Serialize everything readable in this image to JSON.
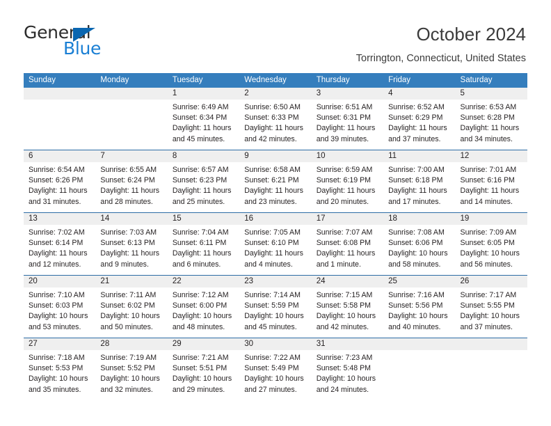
{
  "brand": {
    "name_top": "General",
    "name_bottom": "Blue",
    "accent_color": "#1a7fd4",
    "triangle_color": "#0a66b0"
  },
  "header": {
    "title": "October 2024",
    "subtitle": "Torrington, Connecticut, United States"
  },
  "calendar": {
    "header_bg": "#357ebd",
    "header_text_color": "#ffffff",
    "date_bar_bg": "#efefef",
    "row_divider_color": "#2c6ca5",
    "weekdays": [
      "Sunday",
      "Monday",
      "Tuesday",
      "Wednesday",
      "Thursday",
      "Friday",
      "Saturday"
    ],
    "weeks": [
      [
        {
          "day": "",
          "lines": []
        },
        {
          "day": "",
          "lines": []
        },
        {
          "day": "1",
          "lines": [
            "Sunrise: 6:49 AM",
            "Sunset: 6:34 PM",
            "Daylight: 11 hours",
            "and 45 minutes."
          ]
        },
        {
          "day": "2",
          "lines": [
            "Sunrise: 6:50 AM",
            "Sunset: 6:33 PM",
            "Daylight: 11 hours",
            "and 42 minutes."
          ]
        },
        {
          "day": "3",
          "lines": [
            "Sunrise: 6:51 AM",
            "Sunset: 6:31 PM",
            "Daylight: 11 hours",
            "and 39 minutes."
          ]
        },
        {
          "day": "4",
          "lines": [
            "Sunrise: 6:52 AM",
            "Sunset: 6:29 PM",
            "Daylight: 11 hours",
            "and 37 minutes."
          ]
        },
        {
          "day": "5",
          "lines": [
            "Sunrise: 6:53 AM",
            "Sunset: 6:28 PM",
            "Daylight: 11 hours",
            "and 34 minutes."
          ]
        }
      ],
      [
        {
          "day": "6",
          "lines": [
            "Sunrise: 6:54 AM",
            "Sunset: 6:26 PM",
            "Daylight: 11 hours",
            "and 31 minutes."
          ]
        },
        {
          "day": "7",
          "lines": [
            "Sunrise: 6:55 AM",
            "Sunset: 6:24 PM",
            "Daylight: 11 hours",
            "and 28 minutes."
          ]
        },
        {
          "day": "8",
          "lines": [
            "Sunrise: 6:57 AM",
            "Sunset: 6:23 PM",
            "Daylight: 11 hours",
            "and 25 minutes."
          ]
        },
        {
          "day": "9",
          "lines": [
            "Sunrise: 6:58 AM",
            "Sunset: 6:21 PM",
            "Daylight: 11 hours",
            "and 23 minutes."
          ]
        },
        {
          "day": "10",
          "lines": [
            "Sunrise: 6:59 AM",
            "Sunset: 6:19 PM",
            "Daylight: 11 hours",
            "and 20 minutes."
          ]
        },
        {
          "day": "11",
          "lines": [
            "Sunrise: 7:00 AM",
            "Sunset: 6:18 PM",
            "Daylight: 11 hours",
            "and 17 minutes."
          ]
        },
        {
          "day": "12",
          "lines": [
            "Sunrise: 7:01 AM",
            "Sunset: 6:16 PM",
            "Daylight: 11 hours",
            "and 14 minutes."
          ]
        }
      ],
      [
        {
          "day": "13",
          "lines": [
            "Sunrise: 7:02 AM",
            "Sunset: 6:14 PM",
            "Daylight: 11 hours",
            "and 12 minutes."
          ]
        },
        {
          "day": "14",
          "lines": [
            "Sunrise: 7:03 AM",
            "Sunset: 6:13 PM",
            "Daylight: 11 hours",
            "and 9 minutes."
          ]
        },
        {
          "day": "15",
          "lines": [
            "Sunrise: 7:04 AM",
            "Sunset: 6:11 PM",
            "Daylight: 11 hours",
            "and 6 minutes."
          ]
        },
        {
          "day": "16",
          "lines": [
            "Sunrise: 7:05 AM",
            "Sunset: 6:10 PM",
            "Daylight: 11 hours",
            "and 4 minutes."
          ]
        },
        {
          "day": "17",
          "lines": [
            "Sunrise: 7:07 AM",
            "Sunset: 6:08 PM",
            "Daylight: 11 hours",
            "and 1 minute."
          ]
        },
        {
          "day": "18",
          "lines": [
            "Sunrise: 7:08 AM",
            "Sunset: 6:06 PM",
            "Daylight: 10 hours",
            "and 58 minutes."
          ]
        },
        {
          "day": "19",
          "lines": [
            "Sunrise: 7:09 AM",
            "Sunset: 6:05 PM",
            "Daylight: 10 hours",
            "and 56 minutes."
          ]
        }
      ],
      [
        {
          "day": "20",
          "lines": [
            "Sunrise: 7:10 AM",
            "Sunset: 6:03 PM",
            "Daylight: 10 hours",
            "and 53 minutes."
          ]
        },
        {
          "day": "21",
          "lines": [
            "Sunrise: 7:11 AM",
            "Sunset: 6:02 PM",
            "Daylight: 10 hours",
            "and 50 minutes."
          ]
        },
        {
          "day": "22",
          "lines": [
            "Sunrise: 7:12 AM",
            "Sunset: 6:00 PM",
            "Daylight: 10 hours",
            "and 48 minutes."
          ]
        },
        {
          "day": "23",
          "lines": [
            "Sunrise: 7:14 AM",
            "Sunset: 5:59 PM",
            "Daylight: 10 hours",
            "and 45 minutes."
          ]
        },
        {
          "day": "24",
          "lines": [
            "Sunrise: 7:15 AM",
            "Sunset: 5:58 PM",
            "Daylight: 10 hours",
            "and 42 minutes."
          ]
        },
        {
          "day": "25",
          "lines": [
            "Sunrise: 7:16 AM",
            "Sunset: 5:56 PM",
            "Daylight: 10 hours",
            "and 40 minutes."
          ]
        },
        {
          "day": "26",
          "lines": [
            "Sunrise: 7:17 AM",
            "Sunset: 5:55 PM",
            "Daylight: 10 hours",
            "and 37 minutes."
          ]
        }
      ],
      [
        {
          "day": "27",
          "lines": [
            "Sunrise: 7:18 AM",
            "Sunset: 5:53 PM",
            "Daylight: 10 hours",
            "and 35 minutes."
          ]
        },
        {
          "day": "28",
          "lines": [
            "Sunrise: 7:19 AM",
            "Sunset: 5:52 PM",
            "Daylight: 10 hours",
            "and 32 minutes."
          ]
        },
        {
          "day": "29",
          "lines": [
            "Sunrise: 7:21 AM",
            "Sunset: 5:51 PM",
            "Daylight: 10 hours",
            "and 29 minutes."
          ]
        },
        {
          "day": "30",
          "lines": [
            "Sunrise: 7:22 AM",
            "Sunset: 5:49 PM",
            "Daylight: 10 hours",
            "and 27 minutes."
          ]
        },
        {
          "day": "31",
          "lines": [
            "Sunrise: 7:23 AM",
            "Sunset: 5:48 PM",
            "Daylight: 10 hours",
            "and 24 minutes."
          ]
        },
        {
          "day": "",
          "lines": []
        },
        {
          "day": "",
          "lines": []
        }
      ]
    ]
  }
}
